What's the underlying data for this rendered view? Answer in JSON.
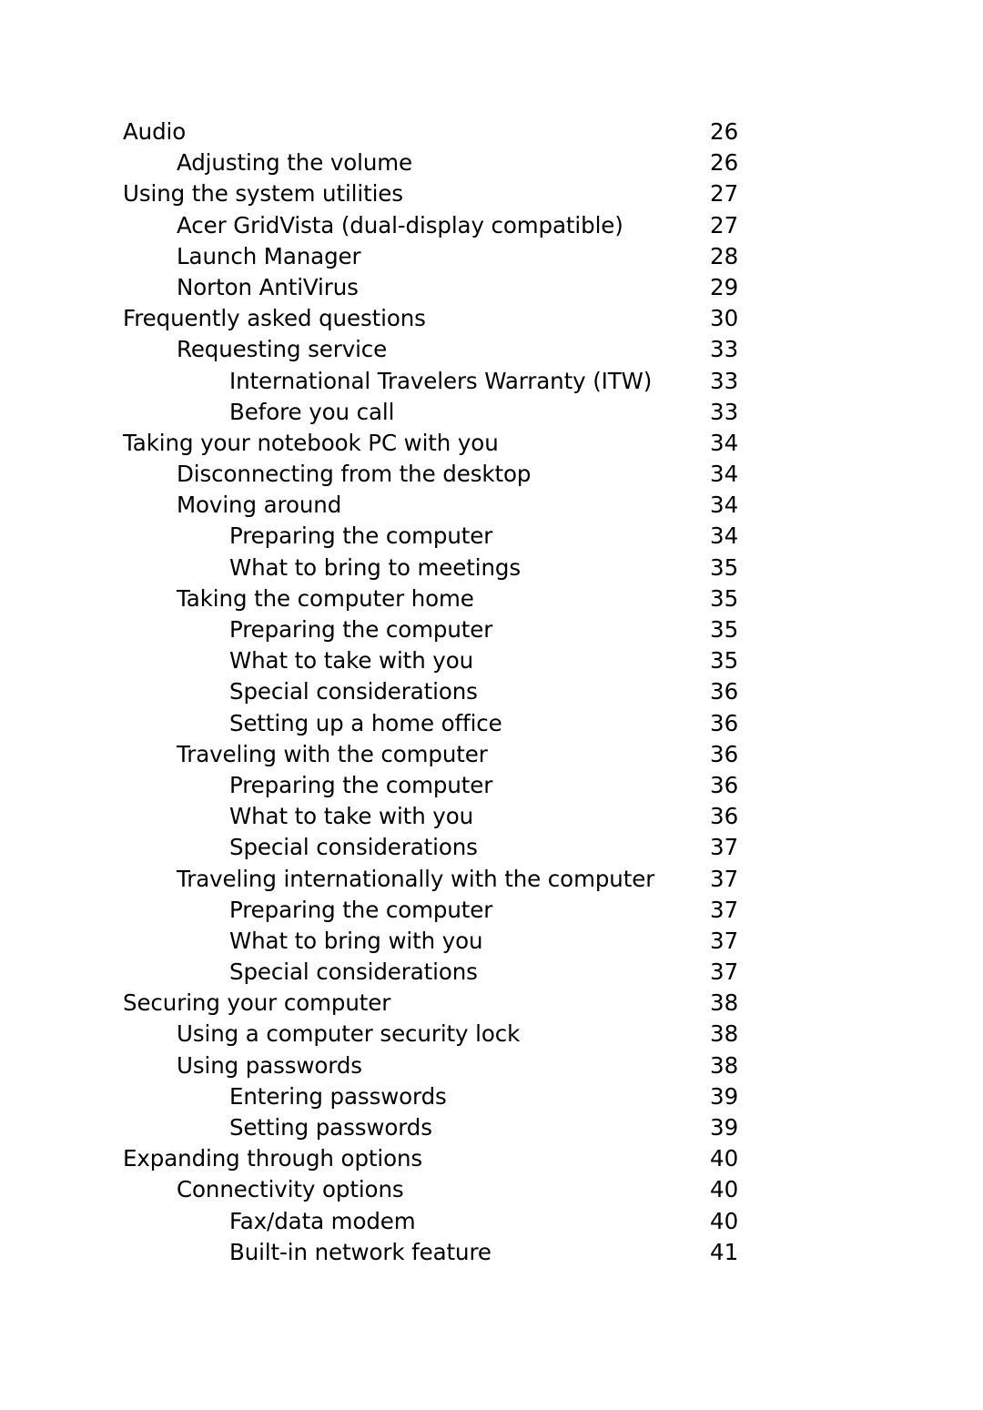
{
  "document": {
    "type": "table-of-contents",
    "entries": [
      {
        "title": "Audio",
        "page": "26",
        "level": 0
      },
      {
        "title": "Adjusting the volume",
        "page": "26",
        "level": 1
      },
      {
        "title": "Using the system utilities",
        "page": "27",
        "level": 0
      },
      {
        "title": "Acer GridVista (dual-display compatible)",
        "page": "27",
        "level": 1
      },
      {
        "title": "Launch Manager",
        "page": "28",
        "level": 1
      },
      {
        "title": "Norton AntiVirus",
        "page": "29",
        "level": 1
      },
      {
        "title": "Frequently asked questions",
        "page": "30",
        "level": 0
      },
      {
        "title": "Requesting service",
        "page": "33",
        "level": 1
      },
      {
        "title": "International Travelers Warranty (ITW)",
        "page": "33",
        "level": 2
      },
      {
        "title": "Before you call",
        "page": "33",
        "level": 2
      },
      {
        "title": "Taking your notebook PC with you",
        "page": "34",
        "level": 0
      },
      {
        "title": "Disconnecting from the desktop",
        "page": "34",
        "level": 1
      },
      {
        "title": "Moving around",
        "page": "34",
        "level": 1
      },
      {
        "title": "Preparing the computer",
        "page": "34",
        "level": 2
      },
      {
        "title": "What to bring to meetings",
        "page": "35",
        "level": 2
      },
      {
        "title": "Taking the computer home",
        "page": "35",
        "level": 1
      },
      {
        "title": "Preparing the computer",
        "page": "35",
        "level": 2
      },
      {
        "title": "What to take with you",
        "page": "35",
        "level": 2
      },
      {
        "title": "Special considerations",
        "page": "36",
        "level": 2
      },
      {
        "title": "Setting up a home office",
        "page": "36",
        "level": 2
      },
      {
        "title": "Traveling with the computer",
        "page": "36",
        "level": 1
      },
      {
        "title": "Preparing the computer",
        "page": "36",
        "level": 2
      },
      {
        "title": "What to take with you",
        "page": "36",
        "level": 2
      },
      {
        "title": "Special considerations",
        "page": "37",
        "level": 2
      },
      {
        "title": "Traveling internationally with the computer",
        "page": "37",
        "level": 1
      },
      {
        "title": "Preparing the computer",
        "page": "37",
        "level": 2
      },
      {
        "title": "What to bring with you",
        "page": "37",
        "level": 2
      },
      {
        "title": "Special considerations",
        "page": "37",
        "level": 2
      },
      {
        "title": "Securing your computer",
        "page": "38",
        "level": 0
      },
      {
        "title": "Using a computer security lock",
        "page": "38",
        "level": 1
      },
      {
        "title": "Using passwords",
        "page": "38",
        "level": 1
      },
      {
        "title": "Entering passwords",
        "page": "39",
        "level": 2
      },
      {
        "title": "Setting passwords",
        "page": "39",
        "level": 2
      },
      {
        "title": "Expanding through options",
        "page": "40",
        "level": 0
      },
      {
        "title": "Connectivity options",
        "page": "40",
        "level": 1
      },
      {
        "title": "Fax/data modem",
        "page": "40",
        "level": 2
      },
      {
        "title": "Built-in network feature",
        "page": "41",
        "level": 2
      }
    ]
  }
}
